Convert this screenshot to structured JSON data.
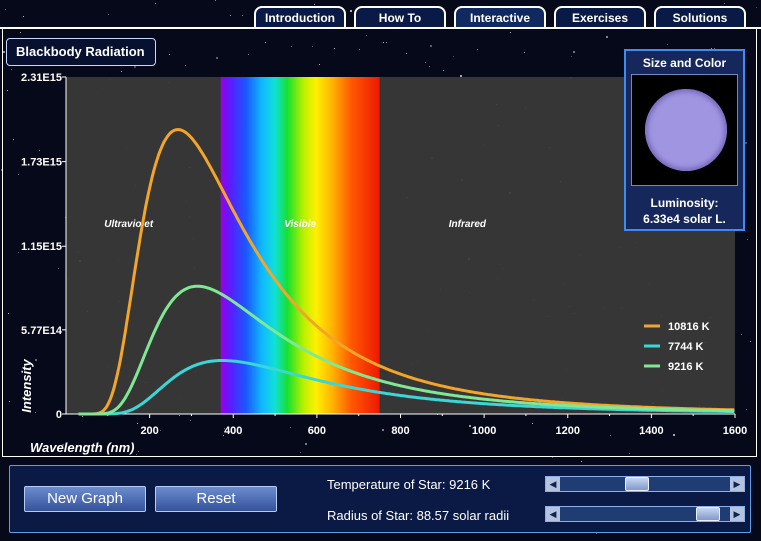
{
  "tabs": [
    "Introduction",
    "How To",
    "Interactive",
    "Exercises",
    "Solutions"
  ],
  "active_tab": "Interactive",
  "panel_title": "Blackbody Radiation",
  "size_box": {
    "title": "Size and Color",
    "star_color": "#a095e0",
    "luminosity_label": "Luminosity:",
    "luminosity_value": "6.33e4 solar L."
  },
  "controls": {
    "new_graph": "New Graph",
    "reset": "Reset",
    "temperature_label": "Temperature of Star: 9216 K",
    "radius_label": "Radius of Star: 88.57 solar radii",
    "temperature_slider_value": 0.44,
    "radius_slider_value": 0.92
  },
  "chart_data": {
    "type": "line",
    "xlabel": "Wavelength (nm)",
    "ylabel": "Intensity",
    "xlim": [
      0,
      1600
    ],
    "ylim": [
      0,
      2310000000000000.0
    ],
    "xticks": [
      200,
      400,
      600,
      800,
      1000,
      1200,
      1400,
      1600
    ],
    "ytick_values": [
      0,
      577000000000000.0,
      1150000000000000.0,
      1730000000000000.0,
      2310000000000000.0
    ],
    "ytick_labels": [
      "0",
      "5.77E14",
      "1.15E15",
      "1.73E15",
      "2.31E15"
    ],
    "regions": [
      {
        "label": "Ultraviolet",
        "x": 150
      },
      {
        "label": "Visible",
        "x": 560
      },
      {
        "label": "Infrared",
        "x": 960
      }
    ],
    "visible_band": [
      370,
      750
    ],
    "legend_position": "right",
    "series": [
      {
        "name": "10816 K",
        "temperature": 10816,
        "color": "#f2a52a"
      },
      {
        "name": "7744 K",
        "temperature": 7744,
        "color": "#3cd6d6"
      },
      {
        "name": "9216 K",
        "temperature": 9216,
        "color": "#7fe894"
      }
    ],
    "grid": false
  }
}
